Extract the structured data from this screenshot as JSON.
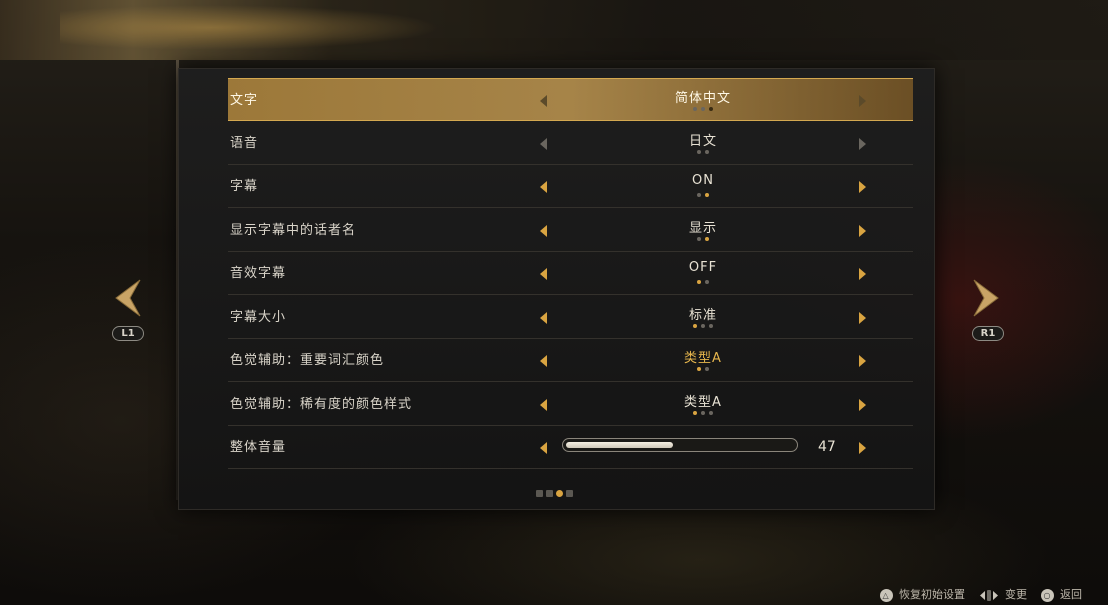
{
  "settings": [
    {
      "label": "文字",
      "value": "简体中文",
      "dots": 3,
      "active_dot": 2,
      "selected": true
    },
    {
      "label": "语音",
      "value": "日文",
      "dots": 2,
      "active_dot": -1,
      "selected": false
    },
    {
      "label": "字幕",
      "value": "ON",
      "dots": 2,
      "active_dot": 1,
      "selected": false
    },
    {
      "label": "显示字幕中的话者名",
      "value": "显示",
      "dots": 2,
      "active_dot": 1,
      "selected": false
    },
    {
      "label": "音效字幕",
      "value": "OFF",
      "dots": 2,
      "active_dot": 0,
      "selected": false
    },
    {
      "label": "字幕大小",
      "value": "标准",
      "dots": 3,
      "active_dot": 0,
      "selected": false
    },
    {
      "label": "色觉辅助：重要词汇颜色",
      "value": "类型A",
      "dots": 2,
      "active_dot": 0,
      "selected": false,
      "value_color": "gold"
    },
    {
      "label": "色觉辅助：稀有度的颜色样式",
      "value": "类型A",
      "dots": 3,
      "active_dot": 0,
      "selected": false
    }
  ],
  "volume": {
    "label": "整体音量",
    "value": "47",
    "fraction": 0.47
  },
  "pagination": {
    "count": 4,
    "active": 2
  },
  "nav": {
    "left_button": "L1",
    "right_button": "R1"
  },
  "footer": {
    "reset_label": "恢复初始设置",
    "change_label": "变更",
    "back_label": "返回"
  },
  "colors": {
    "accent": "#d9a441",
    "highlight": "#b08840",
    "panel": "#1e1e1e"
  },
  "icons": {
    "reset": "triangle-button-icon",
    "change": "dpad-icon",
    "back": "circle-button-icon"
  }
}
